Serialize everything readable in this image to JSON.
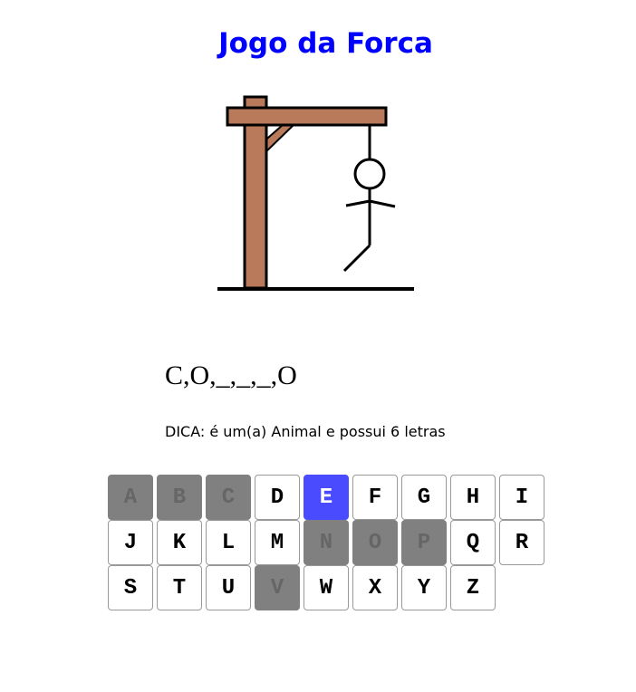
{
  "title": "Jogo da Forca",
  "word_display": "C,O,_,_,_,O",
  "hint": "DICA: é um(a) Animal e possui 6 letras",
  "colors": {
    "title": "#0000ff",
    "gallows_wood": "#b87a5a",
    "key_used": "#808080",
    "key_current": "#4a4aff"
  },
  "hangman_parts_shown": [
    "head",
    "body",
    "left-arm",
    "right-arm",
    "left-leg"
  ],
  "keyboard": [
    {
      "letter": "A",
      "state": "used"
    },
    {
      "letter": "B",
      "state": "used"
    },
    {
      "letter": "C",
      "state": "used"
    },
    {
      "letter": "D",
      "state": "available"
    },
    {
      "letter": "E",
      "state": "current"
    },
    {
      "letter": "F",
      "state": "available"
    },
    {
      "letter": "G",
      "state": "available"
    },
    {
      "letter": "H",
      "state": "available"
    },
    {
      "letter": "I",
      "state": "available"
    },
    {
      "letter": "J",
      "state": "available"
    },
    {
      "letter": "K",
      "state": "available"
    },
    {
      "letter": "L",
      "state": "available"
    },
    {
      "letter": "M",
      "state": "available"
    },
    {
      "letter": "N",
      "state": "used"
    },
    {
      "letter": "O",
      "state": "used"
    },
    {
      "letter": "P",
      "state": "used"
    },
    {
      "letter": "Q",
      "state": "available"
    },
    {
      "letter": "R",
      "state": "available"
    },
    {
      "letter": "S",
      "state": "available"
    },
    {
      "letter": "T",
      "state": "available"
    },
    {
      "letter": "U",
      "state": "available"
    },
    {
      "letter": "V",
      "state": "used"
    },
    {
      "letter": "W",
      "state": "available"
    },
    {
      "letter": "X",
      "state": "available"
    },
    {
      "letter": "Y",
      "state": "available"
    },
    {
      "letter": "Z",
      "state": "available"
    }
  ]
}
